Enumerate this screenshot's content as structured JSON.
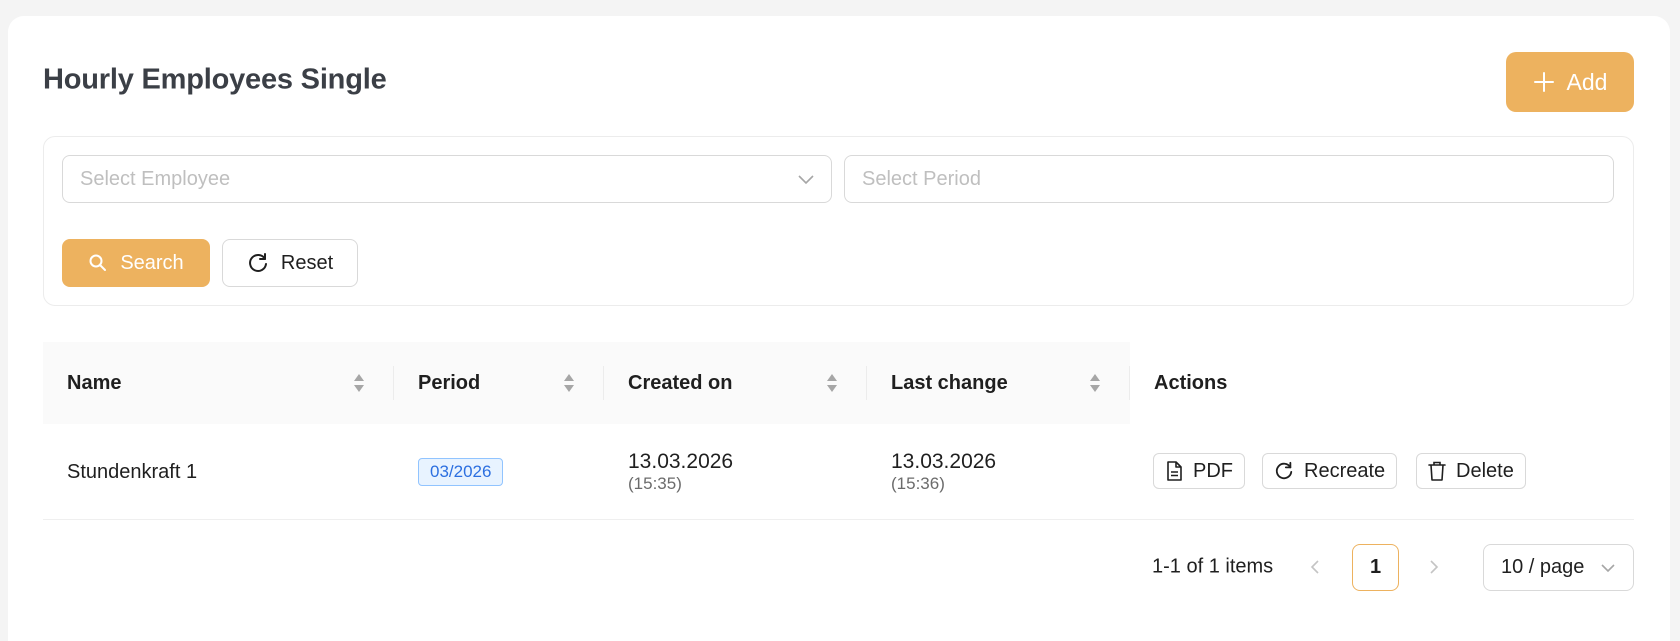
{
  "page": {
    "title": "Hourly Employees Single",
    "add_label": "Add"
  },
  "filters": {
    "employee_placeholder": "Select Employee",
    "period_placeholder": "Select Period",
    "search_label": "Search",
    "reset_label": "Reset"
  },
  "table": {
    "columns": [
      "Name",
      "Period",
      "Created on",
      "Last change",
      "Actions"
    ],
    "rows": [
      {
        "name": "Stundenkraft 1",
        "period": "03/2026",
        "created_date": "13.03.2026",
        "created_time": "(15:35)",
        "changed_date": "13.03.2026",
        "changed_time": "(15:36)"
      }
    ],
    "actions": {
      "pdf": "PDF",
      "recreate": "Recreate",
      "delete": "Delete"
    }
  },
  "pagination": {
    "summary": "1-1 of 1 items",
    "current_page": "1",
    "page_size": "10 / page"
  },
  "colors": {
    "primary": "#edb25f",
    "tag_blue": "#2c6fe0",
    "border": "#d9d9d9"
  }
}
